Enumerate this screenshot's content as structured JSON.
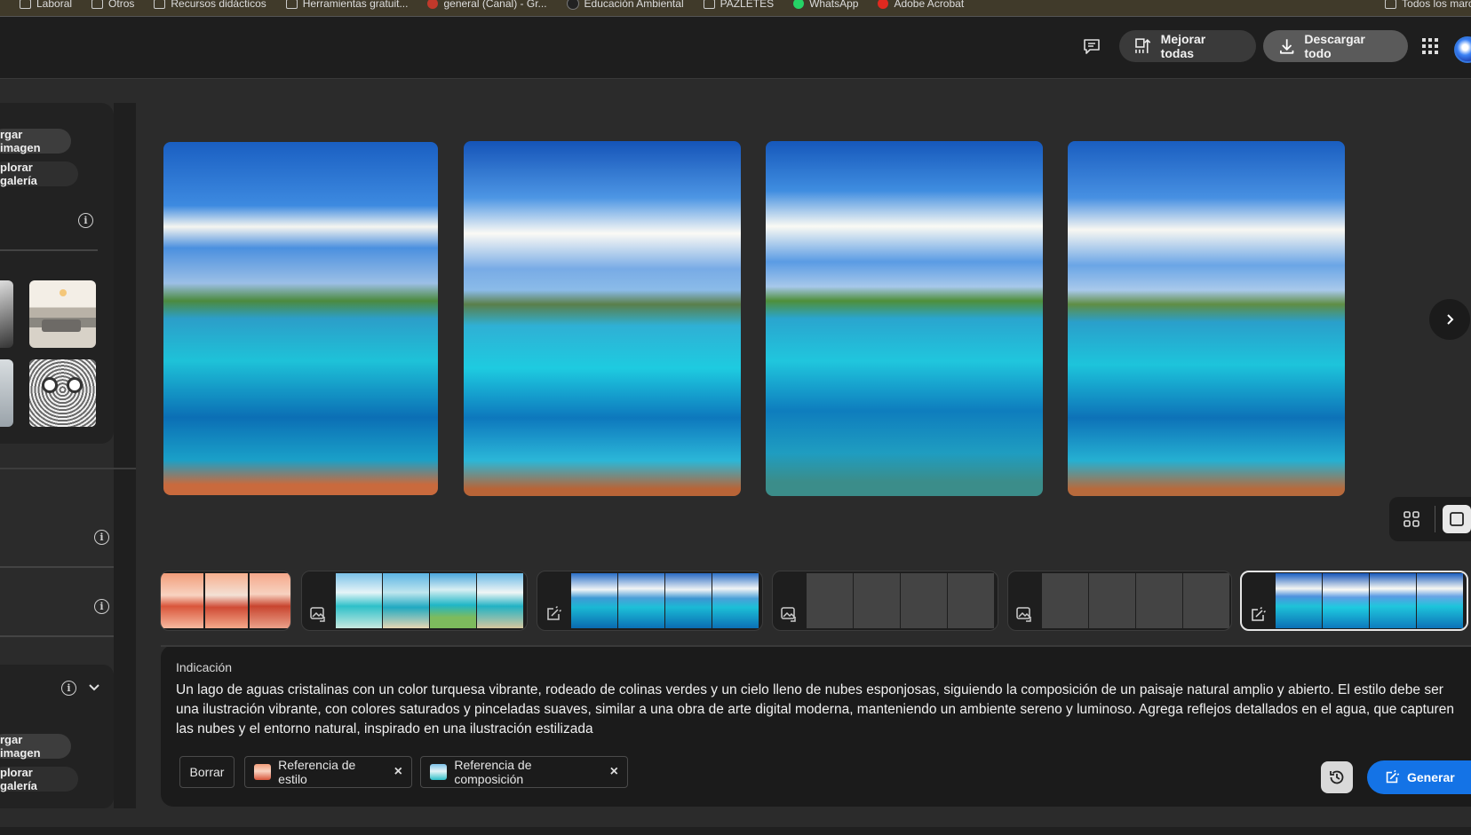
{
  "bookmarks": [
    "Laboral",
    "Otros",
    "Recursos didácticos",
    "Herramientas gratuit...",
    "general (Canal) - Gr...",
    "Educación Ambiental",
    "PAZLETES",
    "WhatsApp",
    "Adobe Acrobat",
    "Todos los marc"
  ],
  "header": {
    "feedback_icon": "feedback-icon",
    "enhance_label": "Mejorar todas",
    "download_label": "Descargar todo",
    "apps_icon": "apps-grid-icon"
  },
  "left_panel": {
    "upload_label": "rgar imagen",
    "gallery_label": "plorar galería",
    "upload_label_2": "rgar imagen",
    "gallery_label_2": "plorar galería",
    "info_glyph": "i"
  },
  "strip": {
    "groups": [
      {
        "icon": "none",
        "active": false
      },
      {
        "icon": "image-reference-icon",
        "active": false
      },
      {
        "icon": "generate-icon",
        "active": false
      },
      {
        "icon": "image-reference-icon",
        "active": false,
        "loading": true
      },
      {
        "icon": "image-reference-icon",
        "active": false,
        "loading": true
      },
      {
        "icon": "generate-icon",
        "active": true
      }
    ]
  },
  "prompt": {
    "label": "Indicación",
    "text": "Un lago de aguas cristalinas con un color turquesa vibrante, rodeado de colinas verdes y un cielo lleno de nubes esponjosas, siguiendo la composición de un paisaje natural amplio y abierto. El estilo debe ser una ilustración vibrante, con colores saturados y pinceladas suaves, similar a una obra de arte digital moderna, manteniendo un ambiente sereno y luminoso. Agrega reflejos detallados en el agua, que capturen las nubes y el entorno natural, inspirado en una ilustración estilizada",
    "clear_label": "Borrar",
    "style_ref_label": "Referencia de estilo",
    "composition_ref_label": "Referencia de composición",
    "remove_glyph": "×",
    "generate_label": "Generar"
  },
  "colors": {
    "accent": "#1473e6",
    "header_bg": "#1e1e1e",
    "page_bg": "#2b2b2b",
    "panel_bg": "#1b1b1b"
  }
}
